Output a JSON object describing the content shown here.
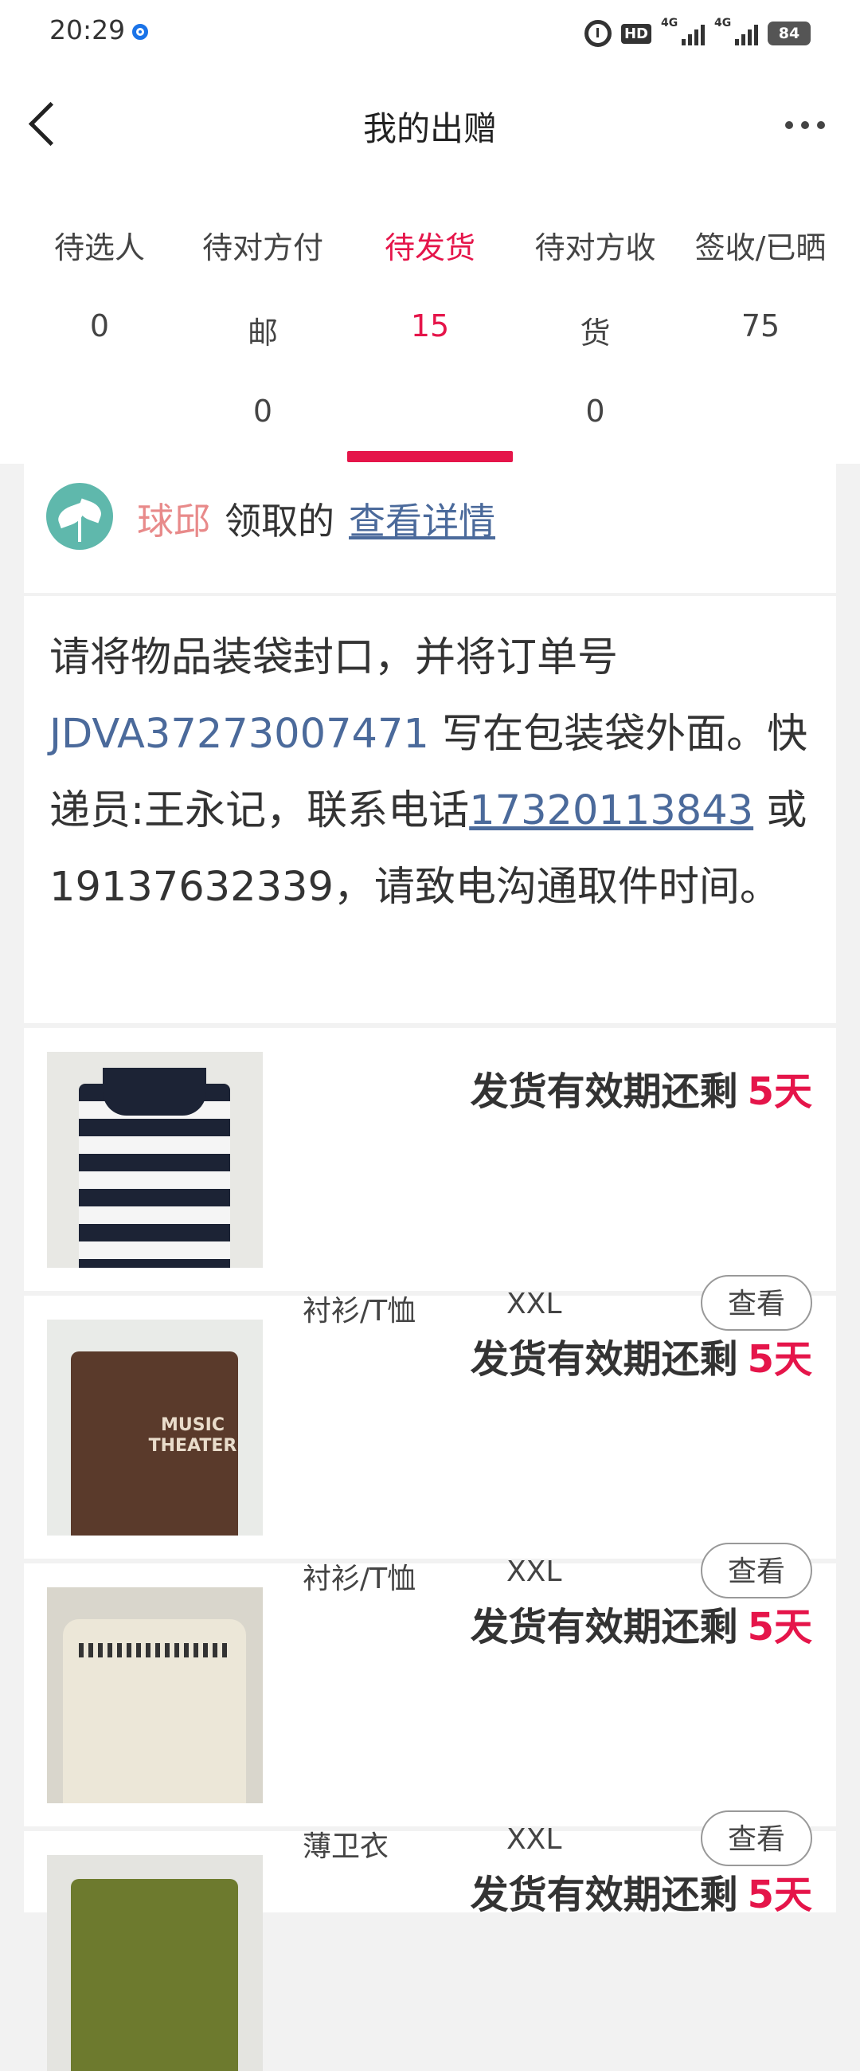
{
  "status_bar": {
    "time": "20:29",
    "hd": "HD",
    "net1": "4G",
    "net2": "4G",
    "battery": "84"
  },
  "header": {
    "title": "我的出赠"
  },
  "tabs": [
    {
      "label": "待选人",
      "count": "0"
    },
    {
      "label": "待对方付",
      "label2": "邮",
      "count": "0"
    },
    {
      "label": "待发货",
      "count": "15"
    },
    {
      "label": "待对方收",
      "label2": "货",
      "count": "0"
    },
    {
      "label": "签收/已晒",
      "count": "75"
    }
  ],
  "claim": {
    "user": "球邱",
    "mid": "领取的",
    "link": "查看详情"
  },
  "notice": {
    "p1": "请将物品装袋封口，并将订单号",
    "order_no": "JDVA37273007471",
    "p2": "写在包装袋外面。快递员:王永记，联系电话",
    "phone1": "17320113843",
    "p3": "或19137632339，请致电沟通取件时间。"
  },
  "items": [
    {
      "category": "",
      "size": "",
      "deadline": "发货有效期还剩",
      "days": "5天"
    },
    {
      "category": "衬衫/T恤",
      "size": "XXL",
      "view": "查看",
      "deadline": "发货有效期还剩",
      "days": "5天",
      "print": "MUSIC THEATER"
    },
    {
      "category": "衬衫/T恤",
      "size": "XXL",
      "view": "查看",
      "deadline": "发货有效期还剩",
      "days": "5天"
    },
    {
      "category": "薄卫衣",
      "size": "XXL",
      "view": "查看",
      "deadline": "发货有效期还剩",
      "days": "5天"
    }
  ],
  "colors": {
    "accent": "#e5154a",
    "link": "#4b6a9b",
    "user": "#e88a8a"
  }
}
